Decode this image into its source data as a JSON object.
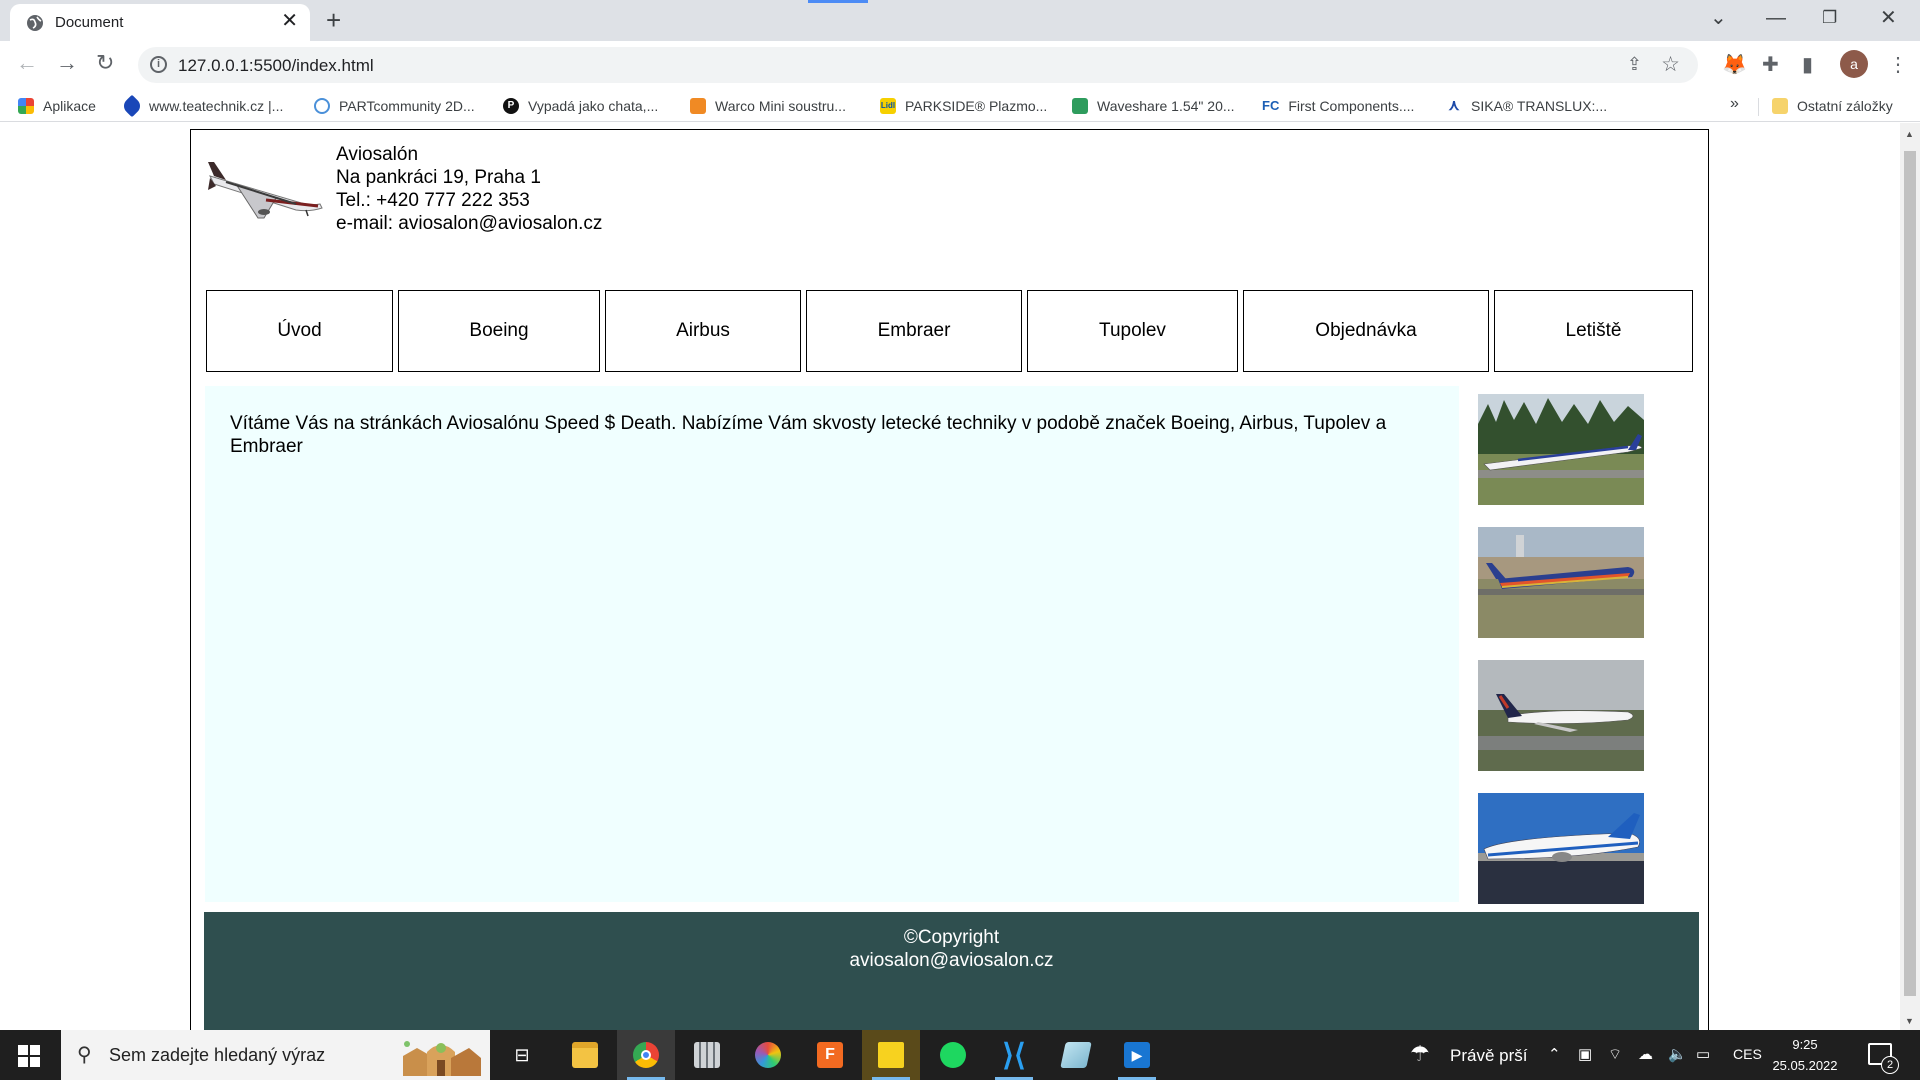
{
  "browser": {
    "tab_title": "Document",
    "tab_close_icon": "close-icon",
    "new_tab_icon": "plus-icon",
    "url": "127.0.0.1:5500/index.html",
    "window_controls": {
      "list": "⌄",
      "minimize": "—",
      "restore": "❐",
      "close": "✕"
    },
    "nav": {
      "back": "←",
      "forward": "→",
      "reload": "↻"
    },
    "avatar_letter": "a",
    "bookmarks": [
      {
        "label": "Aplikace",
        "color": "#ea4335"
      },
      {
        "label": "www.teatechnik.cz |...",
        "color": "#1a47b8"
      },
      {
        "label": "PARTcommunity 2D...",
        "color": "#4a90d9"
      },
      {
        "label": "Vypadá jako chata,...",
        "color": "#111111"
      },
      {
        "label": "Warco Mini soustru...",
        "color": "#f08a24"
      },
      {
        "label": "PARKSIDE® Plazmo...",
        "color": "#f6d000"
      },
      {
        "label": "Waveshare 1.54\" 20...",
        "color": "#2e9c5d"
      },
      {
        "label": "First Components....",
        "color": "#1c5fb5"
      },
      {
        "label": "SIKA® TRANSLUX:...",
        "color": "#1e4aa8"
      }
    ],
    "bookmarks_more": "»",
    "other_bookmarks": "Ostatní záložky"
  },
  "site": {
    "contact": {
      "name": "Aviosalón",
      "address": "Na pankráci 19, Praha 1",
      "phone": "Tel.: +420 777 222 353",
      "email": "e-mail: aviosalon@aviosalon.cz"
    },
    "menu": [
      "Úvod",
      "Boeing",
      "Airbus",
      "Embraer",
      "Tupolev",
      "Objednávka",
      "Letiště"
    ],
    "welcome_text": "Vítáme Vás na stránkách Aviosalónu Speed $ Death. Nabízíme Vám skvosty letecké techniky v podobě značek Boeing, Airbus, Tupolev a Embraer",
    "gallery": [
      {
        "name": "plane-photo-1",
        "sky": "#c9d4dc",
        "ground": "#7a8a55"
      },
      {
        "name": "plane-photo-2",
        "sky": "#a9b8c7",
        "ground": "#8b8a66"
      },
      {
        "name": "plane-photo-3",
        "sky": "#b4b9bd",
        "ground": "#5f6b4d"
      },
      {
        "name": "plane-photo-4",
        "sky": "#2f6fc2",
        "ground": "#9b9a95"
      }
    ],
    "footer": {
      "copyright": "©Copyright",
      "email": "aviosalon@aviosalon.cz"
    },
    "colors": {
      "content_bg": "#f0ffff",
      "footer_bg": "#2f4f4f"
    }
  },
  "taskbar": {
    "search_placeholder": "Sem zadejte hledaný výraz",
    "weather": "Právě prší",
    "language": "CES",
    "time": "9:25",
    "date": "25.05.2022",
    "notifications_count": "2"
  }
}
